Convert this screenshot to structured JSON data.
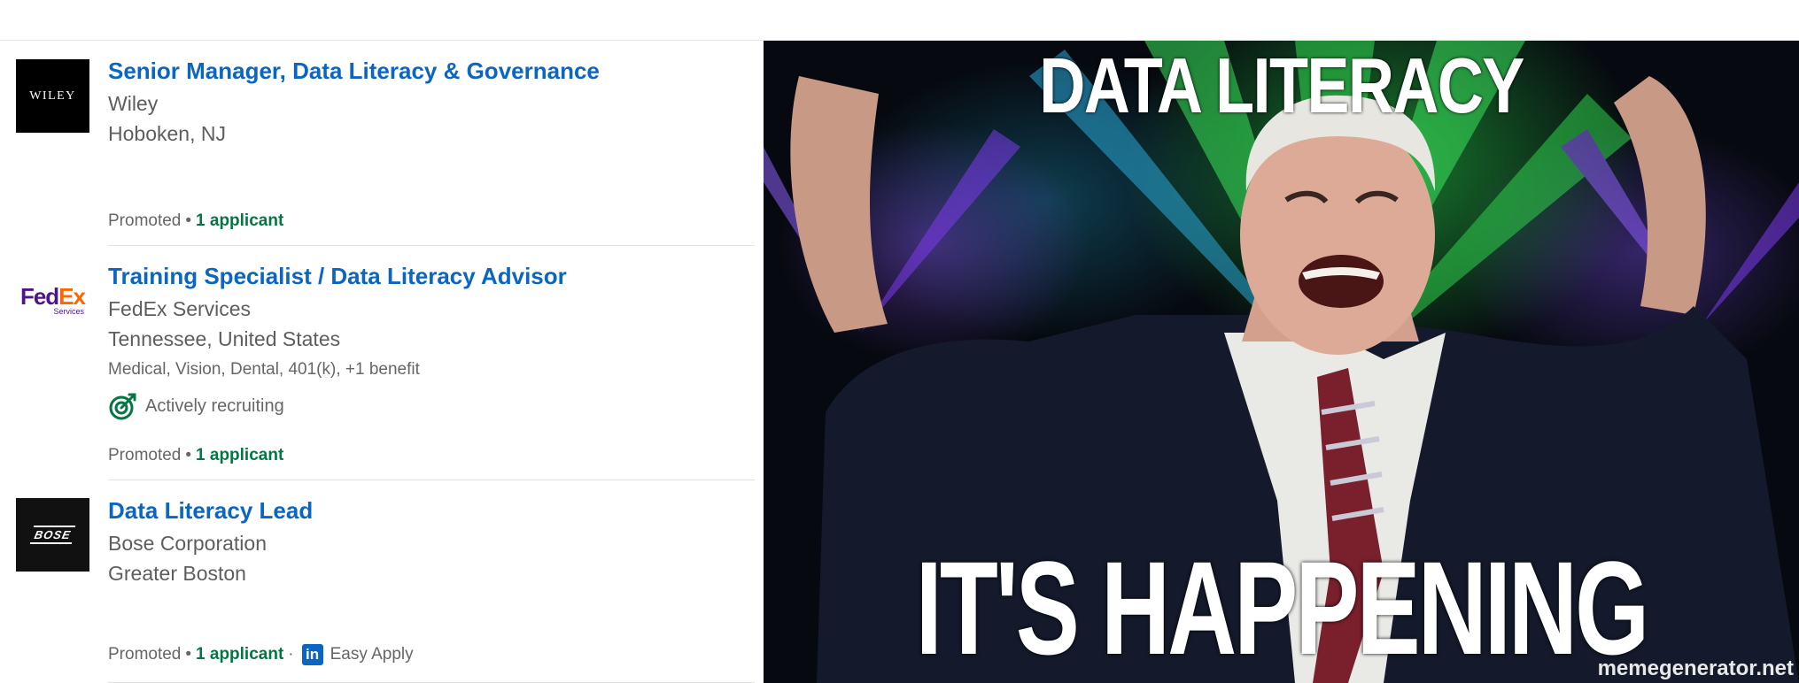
{
  "jobs": [
    {
      "company_logo_text": "WILEY",
      "title": "Senior Manager, Data Literacy & Governance",
      "company": "Wiley",
      "location": "Hoboken, NJ",
      "footer": {
        "promoted": "Promoted",
        "separator": "•",
        "applicants": "1 applicant"
      }
    },
    {
      "company_logo_text": "FedEx",
      "company_logo_sub": "Services",
      "title": "Training Specialist / Data Literacy Advisor",
      "company": "FedEx Services",
      "location": "Tennessee, United States",
      "benefits": "Medical, Vision, Dental, 401(k), +1 benefit",
      "recruiting": "Actively recruiting",
      "footer": {
        "promoted": "Promoted",
        "separator": "•",
        "applicants": "1 applicant"
      }
    },
    {
      "company_logo_text": "BOSE",
      "title": "Data Literacy Lead",
      "company": "Bose Corporation",
      "location": "Greater Boston",
      "footer": {
        "promoted": "Promoted",
        "separator": "•",
        "applicants": "1 applicant",
        "separator2": "·",
        "easy_apply": "Easy Apply"
      }
    }
  ],
  "meme": {
    "top_text": "DATA LITERACY",
    "bottom_text": "IT'S HAPPENING",
    "watermark": "memegenerator.net"
  },
  "colors": {
    "link_blue": "#0a66c2",
    "applicant_green": "#057642",
    "fedex_purple": "#4d148c",
    "fedex_orange": "#ff6600"
  },
  "icons": {
    "recruiting": "target-icon",
    "easy_apply": "linkedin-icon"
  }
}
